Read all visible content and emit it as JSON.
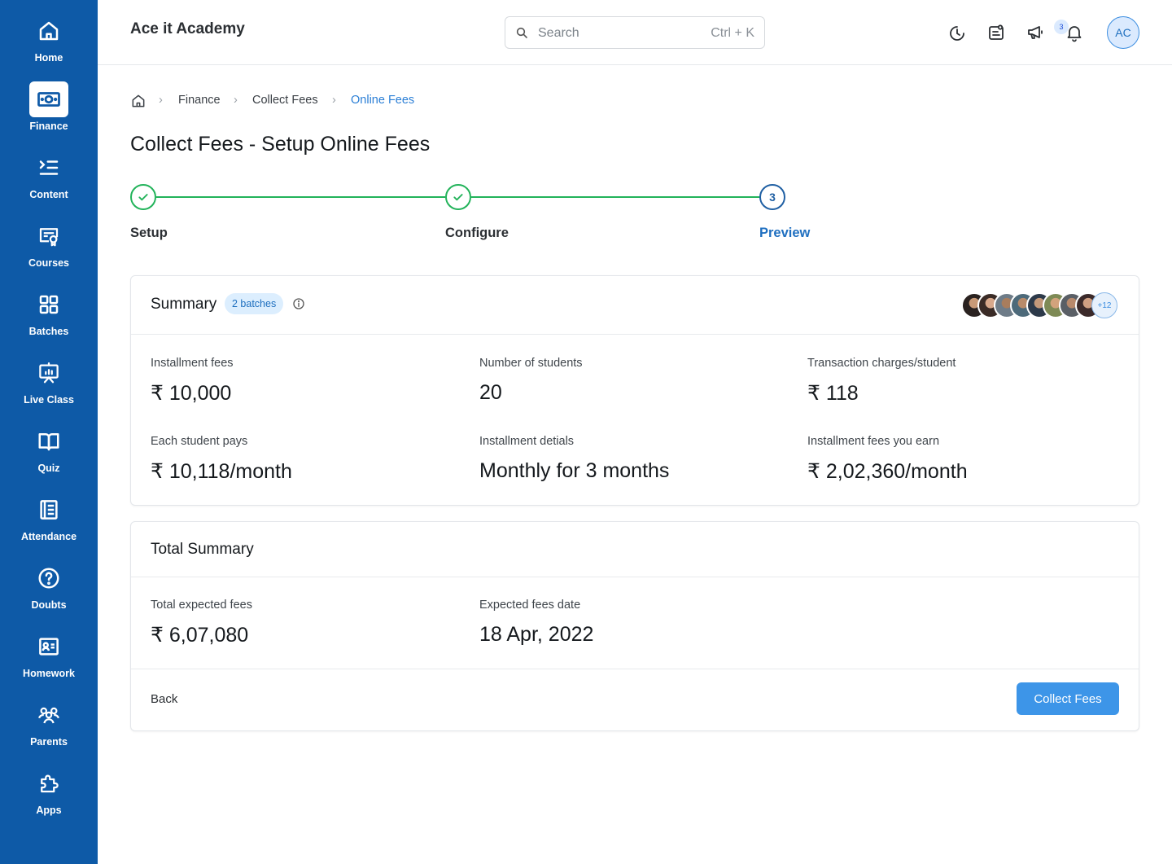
{
  "sidebar": {
    "items": [
      {
        "label": "Home",
        "icon": "home-icon"
      },
      {
        "label": "Finance",
        "icon": "money-icon",
        "active": true
      },
      {
        "label": "Content",
        "icon": "list-icon"
      },
      {
        "label": "Courses",
        "icon": "certificate-icon"
      },
      {
        "label": "Batches",
        "icon": "grid-icon"
      },
      {
        "label": "Live Class",
        "icon": "presentation-icon"
      },
      {
        "label": "Quiz",
        "icon": "book-icon"
      },
      {
        "label": "Attendance",
        "icon": "register-icon"
      },
      {
        "label": "Doubts",
        "icon": "question-icon"
      },
      {
        "label": "Homework",
        "icon": "id-card-icon"
      },
      {
        "label": "Parents",
        "icon": "users-icon"
      },
      {
        "label": "Apps",
        "icon": "puzzle-icon"
      }
    ]
  },
  "header": {
    "app_title": "Ace it Academy",
    "search": {
      "placeholder": "Search",
      "shortcut": "Ctrl + K"
    },
    "activity_badge": "3",
    "avatar_initials": "AC"
  },
  "breadcrumb": [
    "Finance",
    "Collect Fees",
    "Online Fees"
  ],
  "page_title": "Collect Fees - Setup Online Fees",
  "stepper": {
    "steps": [
      "Setup",
      "Configure",
      "Preview"
    ],
    "current_number": "3"
  },
  "summary": {
    "title": "Summary",
    "batches_badge": "2 batches",
    "extra_students": "+12",
    "stats": [
      {
        "label": "Installment fees",
        "value": "₹ 10,000"
      },
      {
        "label": "Number of students",
        "value": "20"
      },
      {
        "label": "Transaction charges/student",
        "value": "₹ 118"
      },
      {
        "label": "Each student pays",
        "value": "₹ 10,118/month"
      },
      {
        "label": "Installment detials",
        "value": "Monthly for 3 months"
      },
      {
        "label": "Installment fees you earn",
        "value": "₹ 2,02,360/month"
      }
    ]
  },
  "total_summary": {
    "title": "Total Summary",
    "stats": [
      {
        "label": "Total expected fees",
        "value": "₹ 6,07,080"
      },
      {
        "label": "Expected fees date",
        "value": "18 Apr, 2022"
      }
    ],
    "back_label": "Back",
    "collect_label": "Collect Fees"
  },
  "colors": {
    "sidebar": "#0e5aa7",
    "success": "#22b35a",
    "primary": "#3d95e8",
    "current_step": "#1f5fa3"
  }
}
